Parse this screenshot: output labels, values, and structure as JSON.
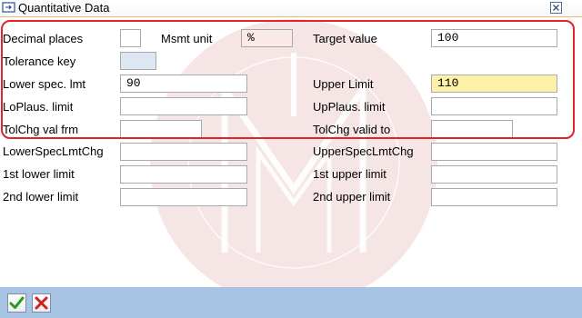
{
  "window": {
    "title": "Quantitative Data",
    "title_icon": "window-icon",
    "close_icon": "close-icon"
  },
  "fields": {
    "decimal_places": {
      "label": "Decimal places",
      "value": ""
    },
    "msmt_unit": {
      "label": "Msmt unit",
      "value": "%"
    },
    "target_value": {
      "label": "Target value",
      "value": "100"
    },
    "tolerance_key": {
      "label": "Tolerance key",
      "value": ""
    },
    "lower_spec_lmt": {
      "label": "Lower spec. lmt",
      "value": "90"
    },
    "upper_limit": {
      "label": "Upper Limit",
      "value": "110"
    },
    "lo_plaus_limit": {
      "label": "LoPlaus. limit",
      "value": ""
    },
    "up_plaus_limit": {
      "label": "UpPlaus. limit",
      "value": ""
    },
    "tolchg_val_frm": {
      "label": "TolChg val frm",
      "value": ""
    },
    "tolchg_valid_to": {
      "label": "TolChg valid to",
      "value": ""
    },
    "lower_spec_lmt_chg": {
      "label": "LowerSpecLmtChg",
      "value": ""
    },
    "upper_spec_lmt_chg": {
      "label": "UpperSpecLmtChg",
      "value": ""
    },
    "first_lower_limit": {
      "label": "1st lower limit",
      "value": ""
    },
    "first_upper_limit": {
      "label": "1st upper limit",
      "value": ""
    },
    "second_lower_limit": {
      "label": "2nd lower limit",
      "value": ""
    },
    "second_upper_limit": {
      "label": "2nd upper limit",
      "value": ""
    }
  },
  "footer": {
    "confirm_icon": "checkmark-icon",
    "cancel_icon": "cancel-x-icon"
  },
  "colors": {
    "highlight_border": "#e0242c",
    "footer_bar": "#a8c4e4",
    "upper_limit_fill": "#fcf1a6",
    "unit_fill": "#fbe9e6"
  }
}
